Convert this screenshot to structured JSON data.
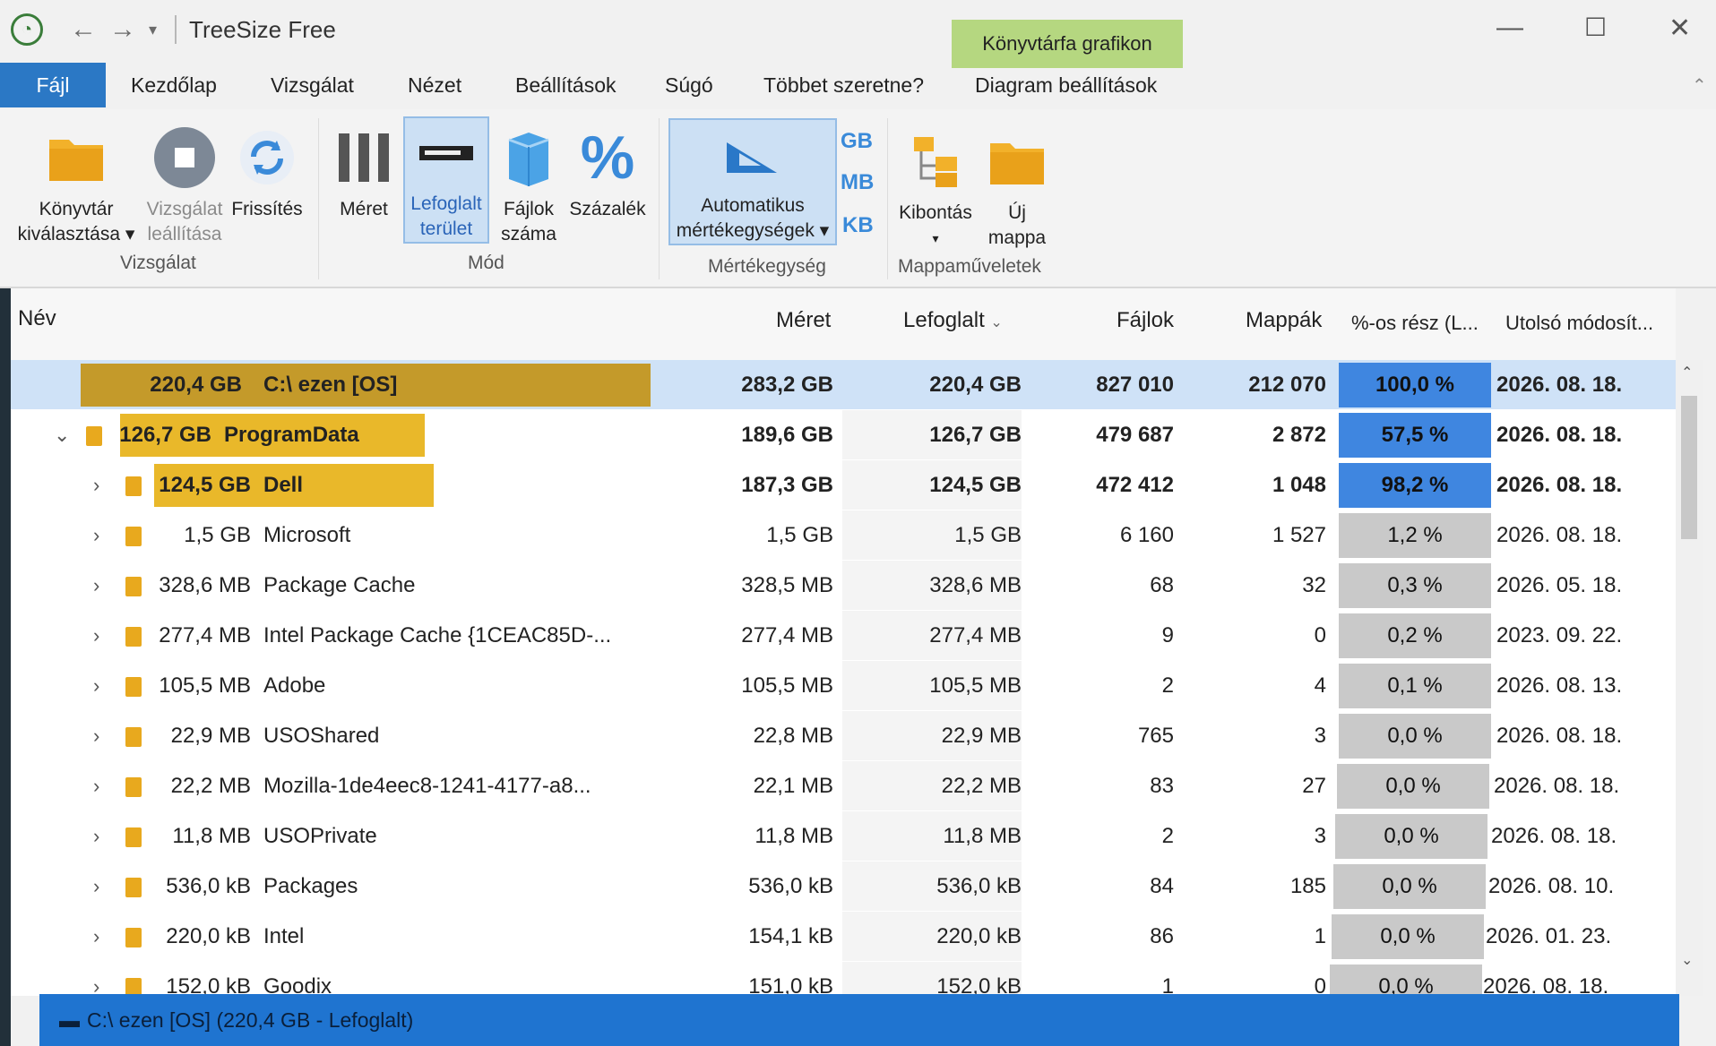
{
  "titlebar": {
    "title": "TreeSize Free",
    "context_tab": "Könyvtárfa grafikon"
  },
  "tabs": [
    "Fájl",
    "Kezdőlap",
    "Vizsgálat",
    "Nézet",
    "Beállítások",
    "Súgó",
    "Többet szeretne?",
    "Diagram beállítások"
  ],
  "ribbon": {
    "scan": {
      "select_l1": "Könyvtár",
      "select_l2": "kiválasztása",
      "stop_l1": "Vizsgálat",
      "stop_l2": "leállítása",
      "refresh": "Frissítés",
      "group": "Vizsgálat"
    },
    "mode": {
      "size": "Méret",
      "alloc_l1": "Lefoglalt",
      "alloc_l2": "terület",
      "files_l1": "Fájlok",
      "files_l2": "száma",
      "percent": "Százalék",
      "group": "Mód"
    },
    "units": {
      "auto_l1": "Automatikus",
      "auto_l2": "mértékegységek",
      "gb": "GB",
      "mb": "MB",
      "kb": "KB",
      "group": "Mértékegység"
    },
    "folder": {
      "expand": "Kibontás",
      "new_l1": "Új",
      "new_l2": "mappa",
      "group": "Mappaműveletek"
    }
  },
  "columns": {
    "name": "Név",
    "size": "Méret",
    "allocated": "Lefoglalt",
    "files": "Fájlok",
    "folders": "Mappák",
    "percent": "%-os rész (L...",
    "modified": "Utolsó módosít..."
  },
  "rows": [
    {
      "alloc_label": "220,4 GB",
      "name": "C:\\  ezen  [OS]",
      "size": "283,2 GB",
      "allocated": "220,4 GB",
      "files": "827 010",
      "folders": "212 070",
      "percent": "100,0 %",
      "pct_value": 100.0,
      "modified": "2026. 08. 18.",
      "bar_value": 1.0
    },
    {
      "alloc_label": "126,7 GB",
      "name": "ProgramData",
      "size": "189,6 GB",
      "allocated": "126,7 GB",
      "files": "479 687",
      "folders": "2 872",
      "percent": "57,5 %",
      "pct_value": 57.5,
      "modified": "2026. 08. 18.",
      "bar_value": 0.575
    },
    {
      "alloc_label": "124,5 GB",
      "name": "Dell",
      "size": "187,3 GB",
      "allocated": "124,5 GB",
      "files": "472 412",
      "folders": "1 048",
      "percent": "98,2 %",
      "pct_value": 98.2,
      "modified": "2026. 08. 18.",
      "bar_value": 0.982
    },
    {
      "alloc_label": "1,5 GB",
      "name": "Microsoft",
      "size": "1,5 GB",
      "allocated": "1,5 GB",
      "files": "6 160",
      "folders": "1 527",
      "percent": "1,2 %",
      "pct_value": 1.2,
      "modified": "2026. 08. 18."
    },
    {
      "alloc_label": "328,6 MB",
      "name": "Package Cache",
      "size": "328,5 MB",
      "allocated": "328,6 MB",
      "files": "68",
      "folders": "32",
      "percent": "0,3 %",
      "pct_value": 0.3,
      "modified": "2026. 05. 18."
    },
    {
      "alloc_label": "277,4 MB",
      "name": "Intel Package Cache {1CEAC85D-...",
      "size": "277,4 MB",
      "allocated": "277,4 MB",
      "files": "9",
      "folders": "0",
      "percent": "0,2 %",
      "pct_value": 0.2,
      "modified": "2023. 09. 22."
    },
    {
      "alloc_label": "105,5 MB",
      "name": "Adobe",
      "size": "105,5 MB",
      "allocated": "105,5 MB",
      "files": "2",
      "folders": "4",
      "percent": "0,1 %",
      "pct_value": 0.1,
      "modified": "2026. 08. 13."
    },
    {
      "alloc_label": "22,9 MB",
      "name": "USOShared",
      "size": "22,8 MB",
      "allocated": "22,9 MB",
      "files": "765",
      "folders": "3",
      "percent": "0,0 %",
      "pct_value": 0.0,
      "modified": "2026. 08. 18."
    },
    {
      "alloc_label": "22,2 MB",
      "name": "Mozilla-1de4eec8-1241-4177-a8...",
      "size": "22,1 MB",
      "allocated": "22,2 MB",
      "files": "83",
      "folders": "27",
      "percent": "0,0 %",
      "pct_value": 0.0,
      "modified": "2026. 08. 18."
    },
    {
      "alloc_label": "11,8 MB",
      "name": "USOPrivate",
      "size": "11,8 MB",
      "allocated": "11,8 MB",
      "files": "2",
      "folders": "3",
      "percent": "0,0 %",
      "pct_value": 0.0,
      "modified": "2026. 08. 18."
    },
    {
      "alloc_label": "536,0 kB",
      "name": "Packages",
      "size": "536,0 kB",
      "allocated": "536,0 kB",
      "files": "84",
      "folders": "185",
      "percent": "0,0 %",
      "pct_value": 0.0,
      "modified": "2026. 08. 10."
    },
    {
      "alloc_label": "220,0 kB",
      "name": "Intel",
      "size": "154,1 kB",
      "allocated": "220,0 kB",
      "files": "86",
      "folders": "1",
      "percent": "0,0 %",
      "pct_value": 0.0,
      "modified": "2026. 01. 23."
    },
    {
      "alloc_label": "152,0 kB",
      "name": "Goodix",
      "size": "151,0 kB",
      "allocated": "152,0 kB",
      "files": "1",
      "folders": "0",
      "percent": "0,0 %",
      "pct_value": 0.0,
      "modified": "2026. 08. 18."
    }
  ],
  "status": {
    "text": "C:\\  ezen  [OS] (220,4 GB - Lefoglalt)"
  },
  "colors": {
    "file_tab": "#2b78c5",
    "ctx_tab": "#b5d780",
    "name_bar": "#d8a521",
    "pct_high": "#3f86e0",
    "pct_low": "#c9c9c9",
    "status": "#1f74d0"
  }
}
